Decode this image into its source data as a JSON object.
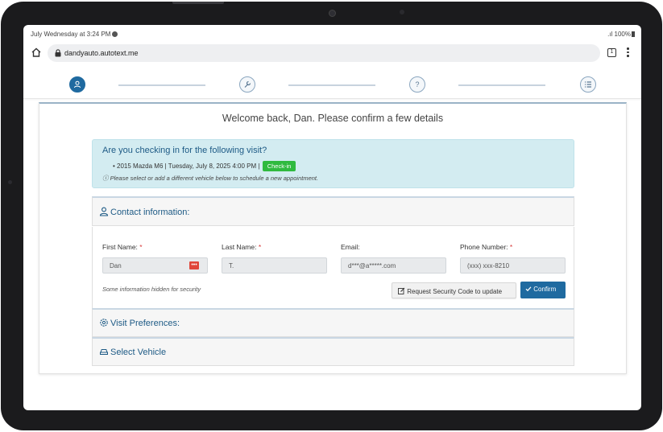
{
  "status_bar": {
    "time": "July Wednesday at 3:24 PM",
    "signal": ".ıl",
    "battery": "100%"
  },
  "browser": {
    "url": "dandyauto.autotext.me",
    "tab_count": "1"
  },
  "stepper": {
    "steps": [
      "contact",
      "service",
      "questions",
      "summary"
    ],
    "active_index": 0
  },
  "page": {
    "welcome": "Welcome back, Dan. Please confirm a few details"
  },
  "visit_alert": {
    "title": "Are you checking in for the following visit?",
    "visit": "2015 Mazda M6 | Tuesday, July 8, 2025 4:00 PM |",
    "checkin_label": "Check-in",
    "note": "Please select or add a different vehicle below to schedule a new appointment."
  },
  "contact": {
    "title": "Contact information:",
    "first_name": {
      "label": "First Name:",
      "required": "*",
      "value": "Dan"
    },
    "last_name": {
      "label": "Last Name:",
      "required": "*",
      "value": "T."
    },
    "email": {
      "label": "Email:",
      "value": "d***@a*****.com"
    },
    "phone": {
      "label": "Phone Number:",
      "required": "*",
      "value": "(xxx) xxx-8210"
    },
    "hidden_note": "Some information hidden for security",
    "request_code_label": "Request Security Code to update",
    "confirm_label": "Confirm"
  },
  "visit_prefs": {
    "title": "Visit Preferences:"
  },
  "select_vehicle": {
    "title": "Select Vehicle"
  },
  "colors": {
    "primary": "#1f6aa0",
    "checkin": "#2fba3f",
    "alert_bg": "#d3ecf1",
    "required": "#d83a3a"
  }
}
